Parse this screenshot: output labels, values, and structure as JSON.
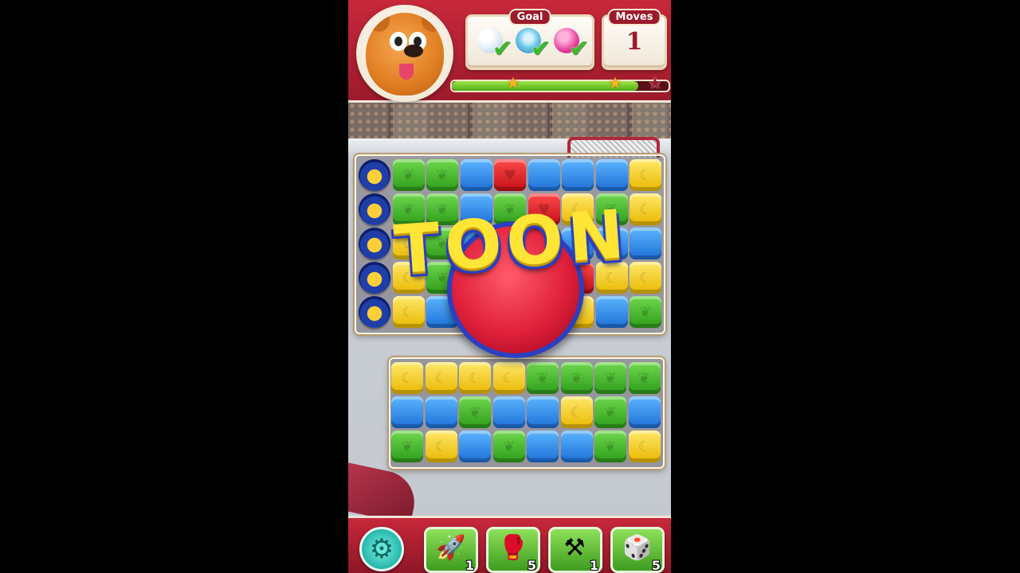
{
  "hud": {
    "goal_label": "Goal",
    "moves_label": "Moves",
    "moves_value": "1",
    "goals": [
      {
        "icon": "bubble-icon",
        "color": "#e8f2ff",
        "completed": true
      },
      {
        "icon": "snow-globe-icon",
        "color": "#6ac7e8",
        "completed": true
      },
      {
        "icon": "pink-ball-icon",
        "color": "#e8409a",
        "completed": true
      }
    ],
    "progress_fraction": 0.86,
    "stars_earned": 2
  },
  "character": {
    "icon": "bear-avatar-icon"
  },
  "overlay": {
    "text": "TOON"
  },
  "board_top": {
    "cols": 9,
    "rows": 5,
    "cells": [
      [
        "coin",
        "green",
        "green",
        "blue",
        "red",
        "blue",
        "blue",
        "blue",
        "yellow"
      ],
      [
        "coin",
        "green",
        "green",
        "blue",
        "green",
        "red",
        "yellow",
        "green",
        "yellow"
      ],
      [
        "coin",
        "yellow",
        "green",
        "blue",
        "blue",
        "blue",
        "blue",
        "blue",
        "blue"
      ],
      [
        "coin",
        "yellow",
        "green",
        "yellow",
        "yellow",
        "red",
        "red",
        "yellow",
        "yellow"
      ],
      [
        "coin",
        "yellow",
        "blue",
        "blue",
        "blue",
        "blue",
        "yellow",
        "blue",
        "green"
      ]
    ]
  },
  "board_bottom": {
    "cols": 8,
    "rows": 3,
    "cells": [
      [
        "yellow",
        "yellow",
        "yellow",
        "yellow",
        "green",
        "green",
        "green",
        "green"
      ],
      [
        "blue",
        "blue",
        "green",
        "blue",
        "blue",
        "yellow",
        "green",
        "blue"
      ],
      [
        "green",
        "yellow",
        "blue",
        "green",
        "blue",
        "blue",
        "green",
        "yellow"
      ]
    ]
  },
  "toolbar": {
    "settings_icon": "gear-icon",
    "boosters": [
      {
        "name": "rocket-booster",
        "icon": "rocket-icon",
        "glyph": "🚀",
        "count": "1"
      },
      {
        "name": "boxing-glove-booster",
        "icon": "boxing-glove-icon",
        "glyph": "🥊",
        "count": "5"
      },
      {
        "name": "anvil-booster",
        "icon": "anvil-icon",
        "glyph": "⚒",
        "count": "1"
      },
      {
        "name": "dice-booster",
        "icon": "dice-icon",
        "glyph": "🎲",
        "count": "5"
      }
    ]
  },
  "colors": {
    "brand_red": "#9c1b2b",
    "cube_green": "#3fb526",
    "cube_blue": "#2a86e8",
    "cube_yellow": "#f4cb10",
    "cube_red": "#d91a24"
  }
}
